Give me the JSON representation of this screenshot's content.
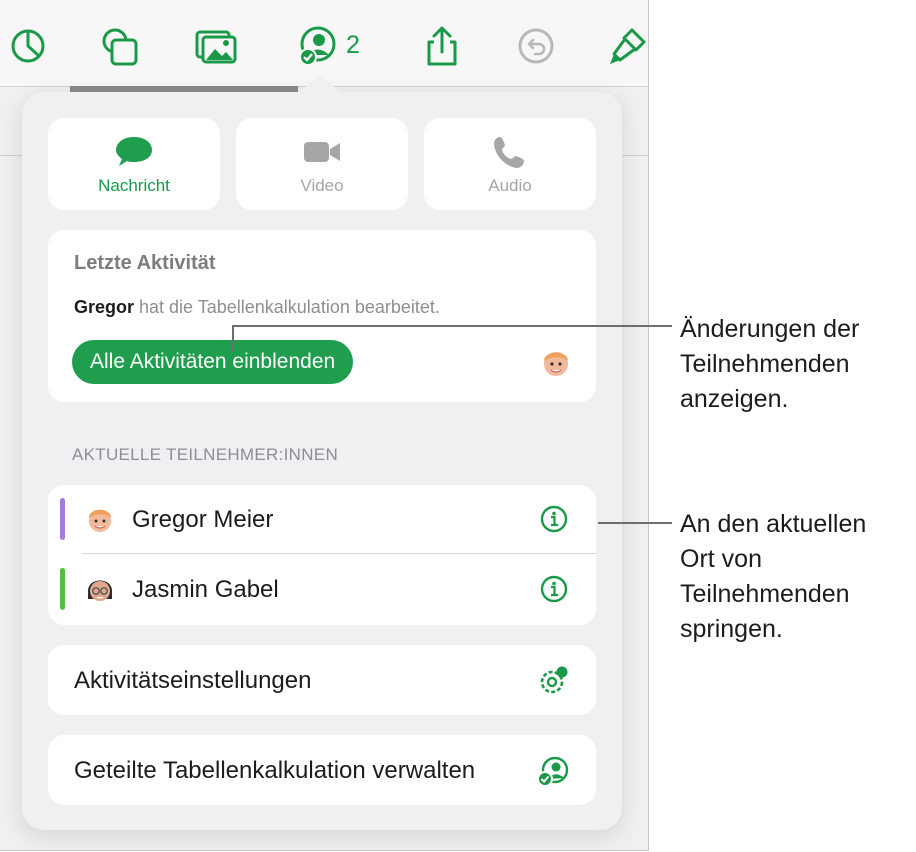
{
  "toolbar": {
    "collaborator_count": "2",
    "icons": [
      "chart-icon",
      "shapes-icon",
      "media-icon",
      "collaborate-icon",
      "share-icon",
      "undo-icon",
      "format-brush-icon"
    ]
  },
  "communication": {
    "message": "Nachricht",
    "video": "Video",
    "audio": "Audio"
  },
  "recent_activity": {
    "title": "Letzte Aktivität",
    "user": "Gregor",
    "action": " hat die Tabellenkalkulation bearbeitet.",
    "show_all_label": "Alle Aktivitäten einblenden"
  },
  "participants": {
    "header": "AKTUELLE TEILNEHMER:INNEN",
    "list": [
      {
        "name": "Gregor Meier",
        "color": "#a67ce0"
      },
      {
        "name": "Jasmin Gabel",
        "color": "#57bd3f"
      }
    ]
  },
  "settings": {
    "activity_settings": "Aktivitätseinstellungen",
    "manage_shared": "Geteilte Tabellenkalkulation verwalten"
  },
  "annotations": {
    "show_changes": [
      "Änderungen der",
      "Teilnehmenden",
      "anzeigen."
    ],
    "jump_to_location": [
      "An den aktuellen",
      "Ort von",
      "Teilnehmenden",
      "springen."
    ]
  },
  "colors": {
    "accent": "#1f9e4d",
    "popover_bg": "#f0f0f2"
  }
}
